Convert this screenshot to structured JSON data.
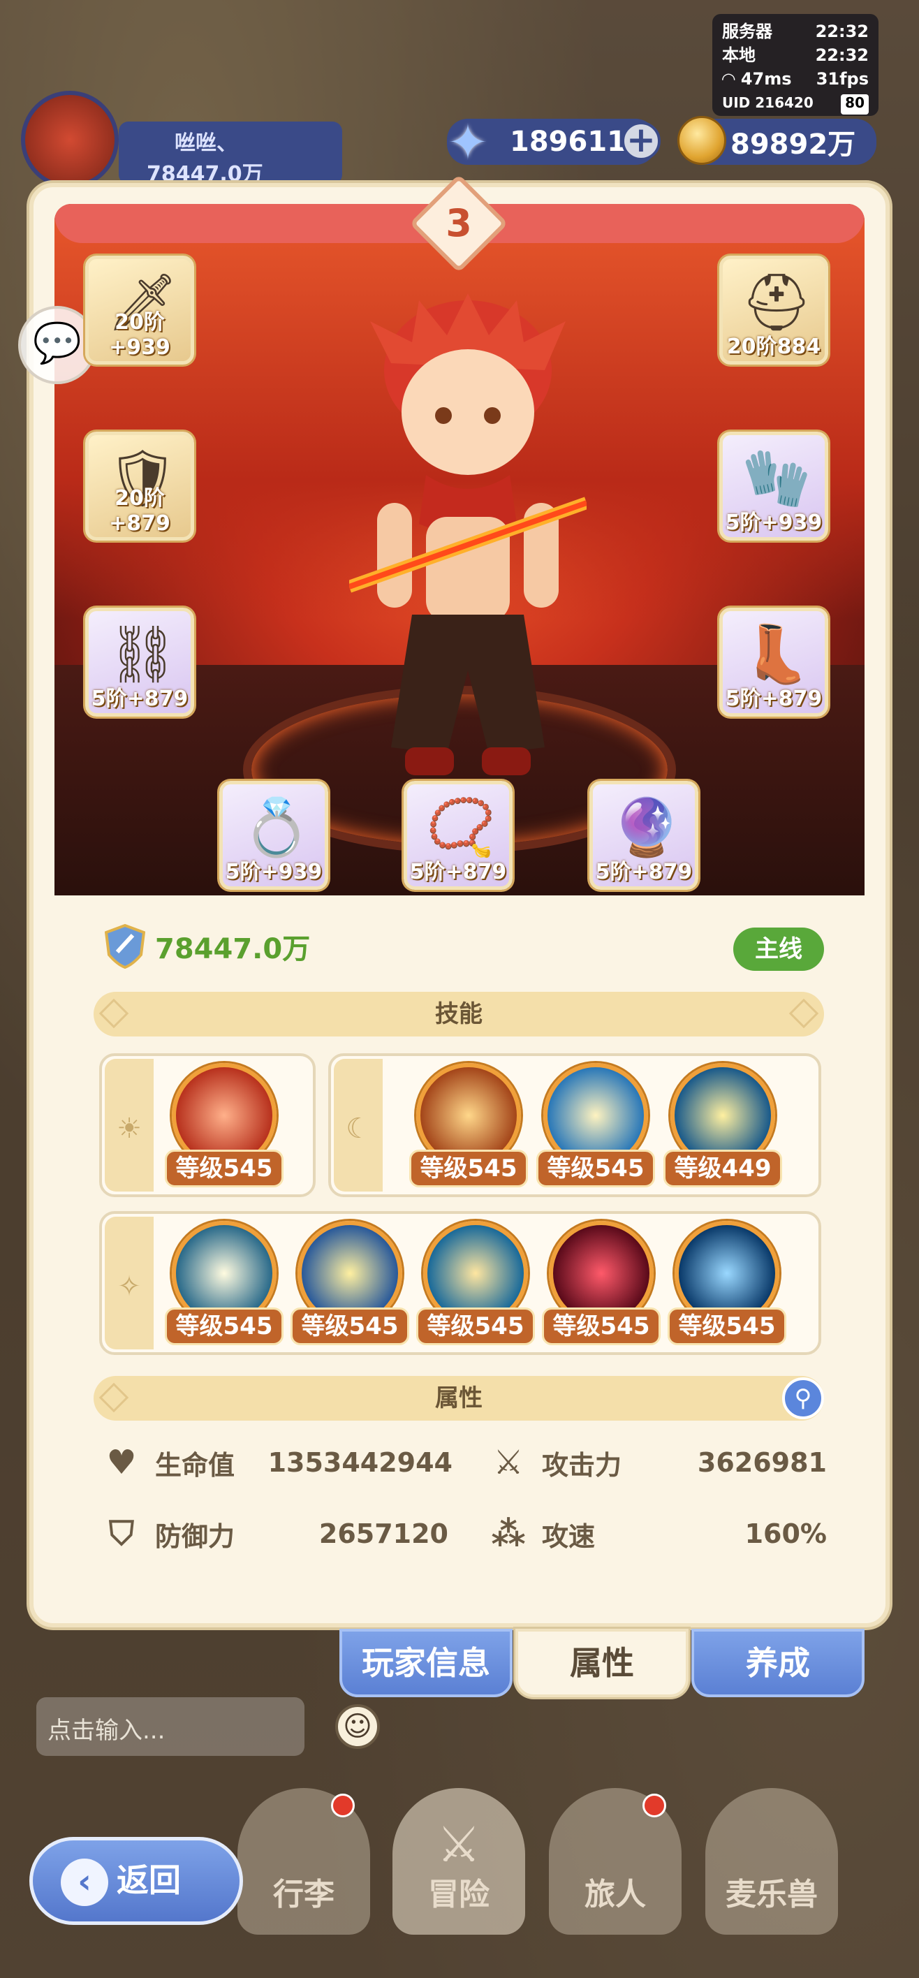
{
  "status": {
    "server_label": "服务器",
    "server_time": "22:32",
    "local_label": "本地",
    "local_time": "22:32",
    "ping": "47ms",
    "fps": "31fps",
    "uid": "UID 216420",
    "battery": "80"
  },
  "player_bar": {
    "name": "咝咝、",
    "power": "78447.0万"
  },
  "resources": {
    "gems": "189611",
    "coins": "89892万"
  },
  "panel": {
    "rank": "3",
    "equipment": [
      {
        "level": "20阶",
        "bonus": "+939",
        "icon": "sword-icon"
      },
      {
        "level": "20阶",
        "bonus": "884",
        "icon": "helmet-icon"
      },
      {
        "level": "20阶",
        "bonus": "+879",
        "icon": "armor-icon"
      },
      {
        "level": "5阶",
        "bonus": "+939",
        "icon": "gauntlet-icon"
      },
      {
        "level": "5阶",
        "bonus": "+879",
        "icon": "belt-icon"
      },
      {
        "level": "5阶",
        "bonus": "+879",
        "icon": "boots-icon"
      },
      {
        "level": "5阶",
        "bonus": "+939",
        "icon": "ring-icon"
      },
      {
        "level": "5阶",
        "bonus": "+879",
        "icon": "necklace-icon"
      },
      {
        "level": "5阶",
        "bonus": "+879",
        "icon": "amulet-icon"
      }
    ],
    "power": "78447.0万",
    "mainline_badge": "主线",
    "skills_title": "技能",
    "skills_row1_left": [
      {
        "label": "等级545"
      }
    ],
    "skills_row1_right": [
      {
        "label": "等级545"
      },
      {
        "label": "等级545"
      },
      {
        "label": "等级449"
      }
    ],
    "skills_row2": [
      {
        "label": "等级545"
      },
      {
        "label": "等级545"
      },
      {
        "label": "等级545"
      },
      {
        "label": "等级545"
      },
      {
        "label": "等级545"
      }
    ],
    "attributes_title": "属性",
    "attributes": {
      "hp_label": "生命值",
      "hp_value": "1353442944",
      "atk_label": "攻击力",
      "atk_value": "3626981",
      "def_label": "防御力",
      "def_value": "2657120",
      "spd_label": "攻速",
      "spd_value": "160%"
    }
  },
  "tabs": {
    "player_info": "玩家信息",
    "attributes": "属性",
    "cultivate": "养成"
  },
  "chat": {
    "placeholder": "点击输入..."
  },
  "nav": {
    "luggage": "行李",
    "adventure": "冒险",
    "traveler": "旅人",
    "pet": "麦乐兽",
    "back": "返回"
  }
}
